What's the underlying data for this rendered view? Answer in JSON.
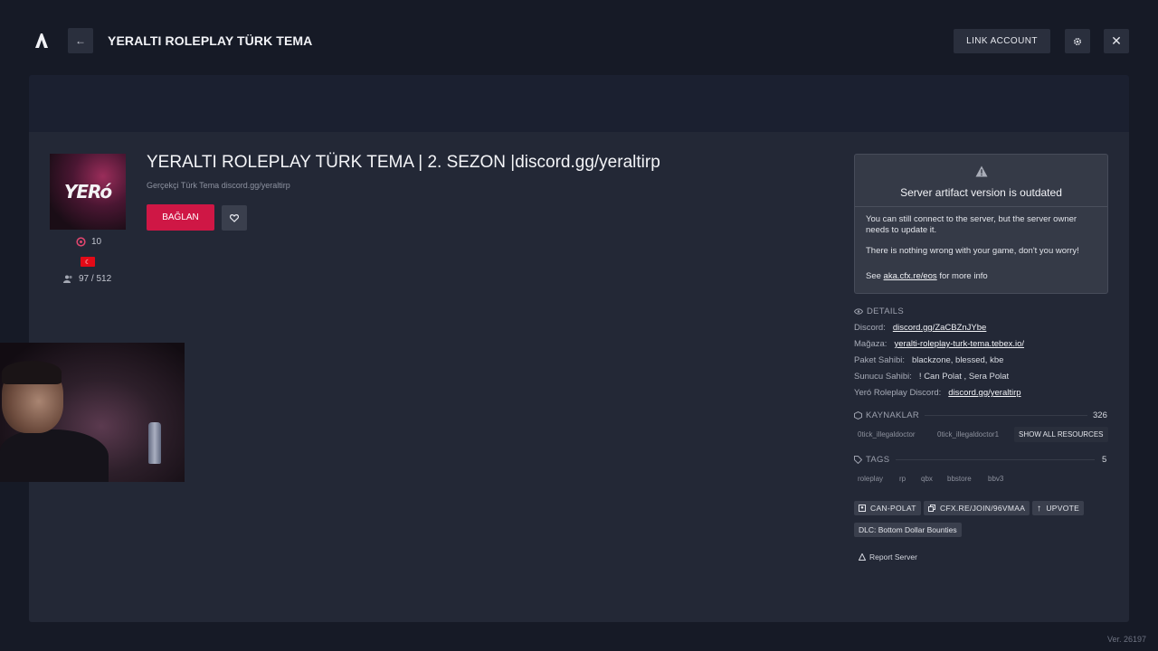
{
  "titlebar": {
    "title": "YERALTI ROLEPLAY TÜRK TEMA",
    "link_account": "LINK ACCOUNT"
  },
  "server": {
    "logo_text": "YERó",
    "name": "YERALTI ROLEPLAY TÜRK TEMA | 2. SEZON |discord.gg/yeraltirp",
    "subtitle": "Gerçekçi Türk Tema discord.gg/yeraltirp",
    "boost": "10",
    "players": "97 / 512",
    "connect_label": "BAĞLAN",
    "brand_color": "#cf1745"
  },
  "warning": {
    "title": "Server artifact version is outdated",
    "line1": "You can still connect to the server, but the server owner needs to update it.",
    "line2": "There is nothing wrong with your game, don't you worry!",
    "see": "See",
    "link": "aka.cfx.re/eos",
    "after": "for more info"
  },
  "details": {
    "label": "DETAILS",
    "rows": [
      {
        "key": "Discord:",
        "value": "discord.gg/ZaCBZnJYbe",
        "link": true
      },
      {
        "key": "Mağaza:",
        "value": "yeralti-roleplay-turk-tema.tebex.io/",
        "link": true
      },
      {
        "key": "Paket Sahibi:",
        "value": "blackzone, blessed, kbe",
        "link": false
      },
      {
        "key": "Sunucu Sahibi:",
        "value": "! Can Polat , Sera Polat",
        "link": false
      },
      {
        "key": "Yeró Roleplay Discord:",
        "value": "discord.gg/yeraltirp",
        "link": true
      }
    ]
  },
  "resources": {
    "label": "KAYNAKLAR",
    "count": "326",
    "items": [
      "0tick_illegaldoctor",
      "0tick_illegaldoctor1"
    ],
    "show_all": "SHOW ALL RESOURCES"
  },
  "tags": {
    "label": "TAGS",
    "count": "5",
    "items": [
      "roleplay",
      "rp",
      "qbx",
      "bbstore",
      "bbv3"
    ]
  },
  "actions": {
    "owner": "CAN-POLAT",
    "join": "CFX.RE/JOIN/96VMAA",
    "upvote": "UPVOTE",
    "dlc": "DLC: Bottom Dollar Bounties",
    "report": "Report Server"
  },
  "version": "Ver. 26197"
}
